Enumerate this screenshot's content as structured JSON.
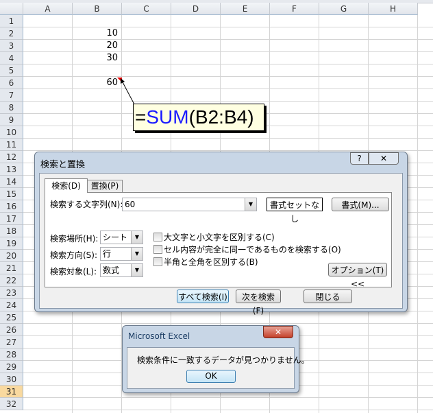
{
  "sheet": {
    "columns": [
      "A",
      "B",
      "C",
      "D",
      "E",
      "F",
      "G",
      "H"
    ],
    "rows": [
      "1",
      "2",
      "3",
      "4",
      "5",
      "6",
      "7",
      "8",
      "9",
      "10",
      "11",
      "12",
      "13",
      "14",
      "15",
      "16",
      "17",
      "18",
      "19",
      "20",
      "21",
      "22",
      "23",
      "24",
      "25",
      "26",
      "27",
      "28",
      "29",
      "30",
      "31",
      "32"
    ],
    "selected_row": "31",
    "cells": {
      "B2": "10",
      "B3": "20",
      "B4": "30",
      "B6": "60"
    }
  },
  "comment": {
    "equals": "=",
    "func": "SUM",
    "args": "(B2:B4)",
    "func_color": "#1a1aff"
  },
  "find_dialog": {
    "title": "検索と置換",
    "help": "?",
    "close": "✕",
    "tabs": [
      "検索(D)",
      "置換(P)"
    ],
    "find_label": "検索する文字列(N):",
    "find_value": "60",
    "format_status": "書式セットなし",
    "format_button": "書式(M)...",
    "within_label": "検索場所(H):",
    "within_value": "シート",
    "search_label": "検索方向(S):",
    "search_value": "行",
    "lookin_label": "検索対象(L):",
    "lookin_value": "数式",
    "checkboxes": [
      "大文字と小文字を区別する(C)",
      "セル内容が完全に同一であるものを検索する(O)",
      "半角と全角を区別する(B)"
    ],
    "options_button": "オプション(T) <<",
    "find_all": "すべて検索(I)",
    "find_next": "次を検索(F)",
    "close_button": "閉じる"
  },
  "message_box": {
    "title": "Microsoft Excel",
    "close": "✕",
    "message": "検索条件に一致するデータが見つかりません。",
    "ok": "OK"
  }
}
